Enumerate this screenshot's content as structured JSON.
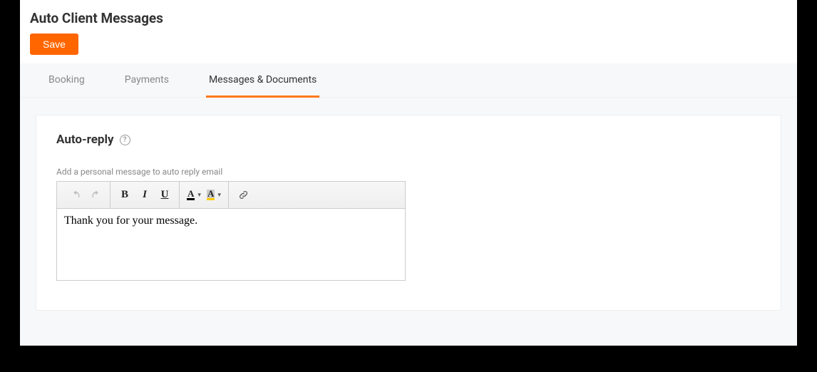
{
  "header": {
    "title": "Auto Client Messages",
    "save_label": "Save"
  },
  "tabs": [
    {
      "label": "Booking",
      "active": false
    },
    {
      "label": "Payments",
      "active": false
    },
    {
      "label": "Messages & Documents",
      "active": true
    }
  ],
  "section": {
    "title": "Auto-reply",
    "help_glyph": "?",
    "field_label": "Add a personal message to auto reply email",
    "editor_content": "Thank you for your message."
  },
  "toolbar": {
    "bold": "B",
    "italic": "I",
    "underline": "U",
    "text_color_glyph": "A",
    "bg_color_glyph": "A",
    "caret": "▾"
  }
}
